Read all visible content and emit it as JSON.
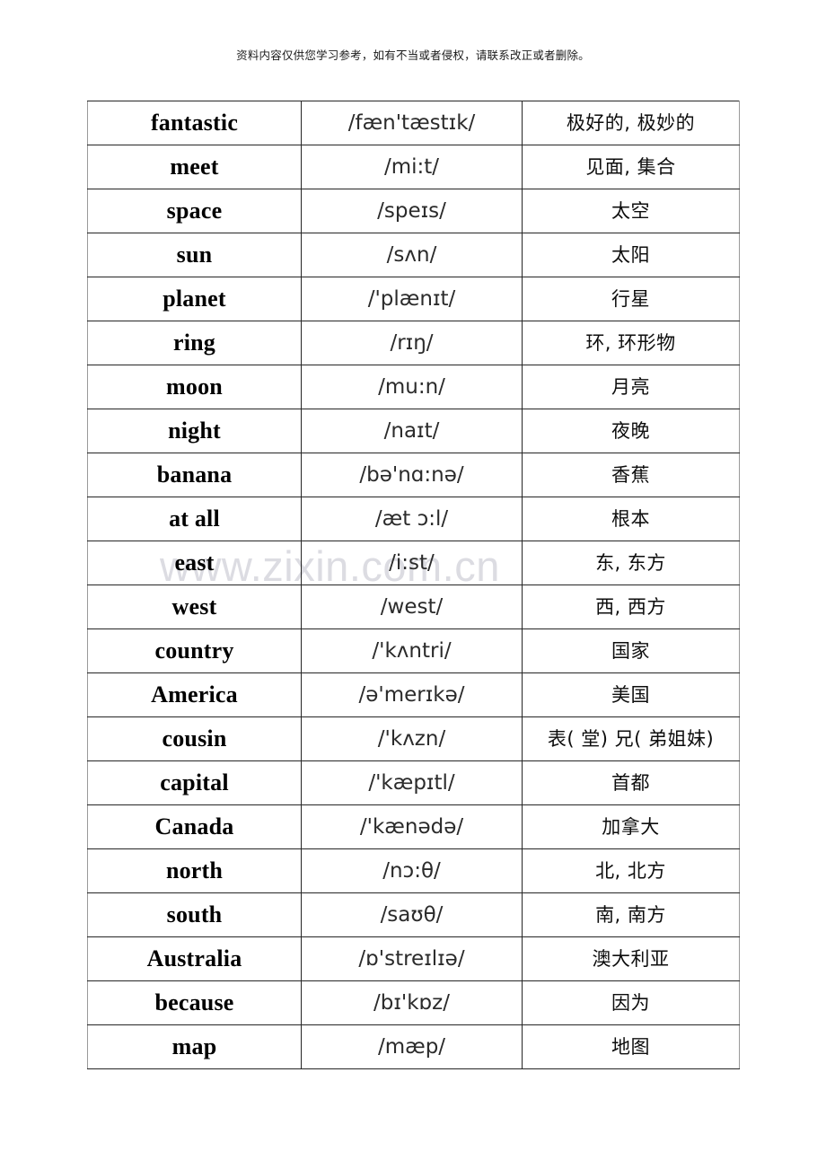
{
  "page": {
    "notice": "资料内容仅供您学习参考，如有不当或者侵权，请联系改正或者删除。",
    "watermark": "www.zixin.com.cn",
    "watermark_color": "#dcdce2",
    "border_color": "#262626",
    "text_color": "#000000"
  },
  "vocab_table": {
    "columns": [
      "word",
      "phonetic",
      "meaning"
    ],
    "rows": [
      {
        "word": "fantastic",
        "phonetic": "/fæn'tæstɪk/",
        "meaning": "极好的, 极妙的"
      },
      {
        "word": "meet",
        "phonetic": "/mi:t/",
        "meaning": "见面, 集合"
      },
      {
        "word": "space",
        "phonetic": "/speɪs/",
        "meaning": "太空"
      },
      {
        "word": "sun",
        "phonetic": "/sʌn/",
        "meaning": "太阳"
      },
      {
        "word": "planet",
        "phonetic": "/'plænɪt/",
        "meaning": "行星"
      },
      {
        "word": "ring",
        "phonetic": "/rɪŋ/",
        "meaning": "环, 环形物"
      },
      {
        "word": "moon",
        "phonetic": "/mu:n/",
        "meaning": "月亮"
      },
      {
        "word": "night",
        "phonetic": "/naɪt/",
        "meaning": "夜晚"
      },
      {
        "word": "banana",
        "phonetic": "/bə'nɑ:nə/",
        "meaning": "香蕉"
      },
      {
        "word": "at all",
        "phonetic": "/æt ɔ:l/",
        "meaning": "根本"
      },
      {
        "word": "east",
        "phonetic": "/i:st/",
        "meaning": "东, 东方"
      },
      {
        "word": "west",
        "phonetic": "/west/",
        "meaning": "西, 西方"
      },
      {
        "word": "country",
        "phonetic": "/'kʌntri/",
        "meaning": "国家"
      },
      {
        "word": "America",
        "phonetic": "/ə'merɪkə/",
        "meaning": "美国"
      },
      {
        "word": "cousin",
        "phonetic": "/'kʌzn/",
        "meaning": "表( 堂) 兄( 弟姐妹)"
      },
      {
        "word": "capital",
        "phonetic": "/'kæpɪtl/",
        "meaning": "首都"
      },
      {
        "word": "Canada",
        "phonetic": "/'kænədə/",
        "meaning": "加拿大"
      },
      {
        "word": "north",
        "phonetic": "/nɔ:θ/",
        "meaning": "北, 北方"
      },
      {
        "word": "south",
        "phonetic": "/saʊθ/",
        "meaning": "南, 南方"
      },
      {
        "word": "Australia",
        "phonetic": "/ɒ'streɪlɪə/",
        "meaning": "澳大利亚"
      },
      {
        "word": "because",
        "phonetic": "/bɪ'kɒz/",
        "meaning": "因为"
      },
      {
        "word": "map",
        "phonetic": "/mæp/",
        "meaning": "地图"
      }
    ]
  }
}
